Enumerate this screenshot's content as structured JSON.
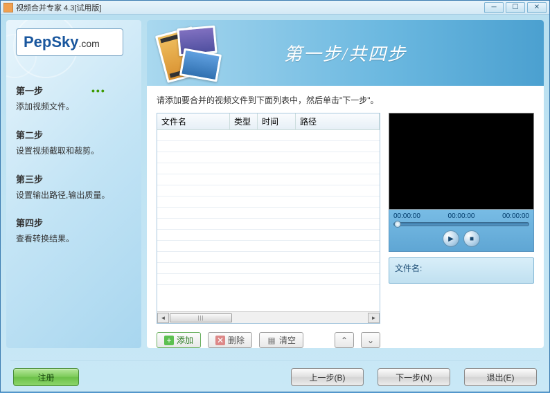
{
  "window": {
    "title": "视频合并专家 4.3[试用版]"
  },
  "logo": {
    "brand": "PepSky",
    "suffix": ".com"
  },
  "header": {
    "step_text": "第一步/共四步"
  },
  "instruction": "请添加要合并的视频文件到下面列表中，然后单击\"下一步\"。",
  "sidebar": {
    "steps": [
      {
        "title": "第一步",
        "desc": "添加视频文件。",
        "active": true
      },
      {
        "title": "第二步",
        "desc": "设置视频截取和裁剪。",
        "active": false
      },
      {
        "title": "第三步",
        "desc": "设置输出路径,输出质量。",
        "active": false
      },
      {
        "title": "第四步",
        "desc": "查看转换结果。",
        "active": false
      }
    ]
  },
  "table": {
    "columns": {
      "name": "文件名",
      "type": "类型",
      "time": "时间",
      "path": "路径"
    }
  },
  "preview": {
    "times": {
      "t1": "00:00:00",
      "t2": "00:00:00",
      "t3": "00:00:00"
    },
    "file_label": "文件名:"
  },
  "buttons": {
    "add": "添加",
    "del": "删除",
    "clear": "清空",
    "register": "注册",
    "prev": "上一步(B)",
    "next": "下一步(N)",
    "exit": "退出(E)"
  }
}
